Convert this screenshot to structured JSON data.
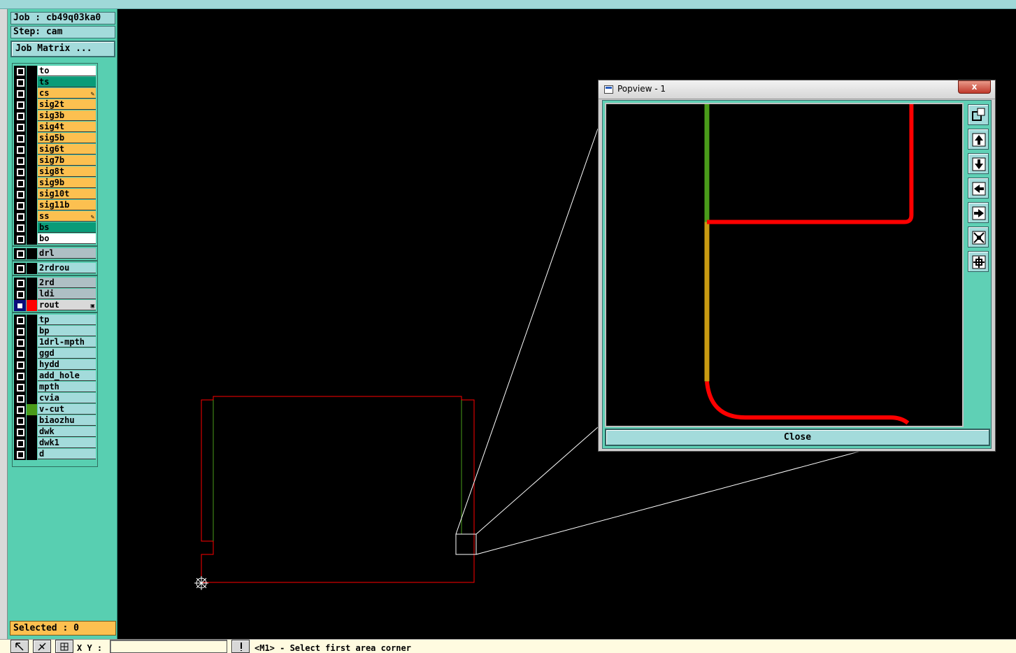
{
  "job": {
    "label": "Job : cb49q03ka0",
    "step_label": "Step: cam",
    "matrix_button": "Job Matrix ..."
  },
  "layers": [
    {
      "name": "to",
      "color": "#ffffff",
      "bg": "#ffffff"
    },
    {
      "name": "ts",
      "color": "#000000",
      "bg": "#0a9b78"
    },
    {
      "name": "cs",
      "color": "#000000",
      "bg": "#fcc050",
      "mark": "✎"
    },
    {
      "name": "sig2t",
      "color": "#000000",
      "bg": "#fcc050"
    },
    {
      "name": "sig3b",
      "color": "#000000",
      "bg": "#fcc050"
    },
    {
      "name": "sig4t",
      "color": "#000000",
      "bg": "#fcc050"
    },
    {
      "name": "sig5b",
      "color": "#000000",
      "bg": "#fcc050"
    },
    {
      "name": "sig6t",
      "color": "#000000",
      "bg": "#fcc050"
    },
    {
      "name": "sig7b",
      "color": "#000000",
      "bg": "#fcc050"
    },
    {
      "name": "sig8t",
      "color": "#000000",
      "bg": "#fcc050"
    },
    {
      "name": "sig9b",
      "color": "#000000",
      "bg": "#fcc050"
    },
    {
      "name": "sig10t",
      "color": "#000000",
      "bg": "#fcc050"
    },
    {
      "name": "sig11b",
      "color": "#000000",
      "bg": "#fcc050"
    },
    {
      "name": "ss",
      "color": "#000000",
      "bg": "#fcc050",
      "mark": "✎"
    },
    {
      "name": "bs",
      "color": "#000000",
      "bg": "#0a9b78"
    },
    {
      "name": "bo",
      "color": "#000000",
      "bg": "#ffffff"
    },
    {
      "name": "drl",
      "color": "#000000",
      "bg": "#aebfc4"
    },
    {
      "name": "2rdrou",
      "color": "#000000",
      "bg": "#a3dbdb"
    },
    {
      "name": "2rd",
      "color": "#000000",
      "bg": "#aebfc4"
    },
    {
      "name": "ldi",
      "color": "#000000",
      "bg": "#aebfc4"
    },
    {
      "name": "rout",
      "color": "#ff0000",
      "bg": "#d9d9d9",
      "mark": "▣",
      "active": true
    },
    {
      "name": "tp",
      "color": "#000000",
      "bg": "#a3dbdb"
    },
    {
      "name": "bp",
      "color": "#000000",
      "bg": "#a3dbdb"
    },
    {
      "name": "1drl-mpth",
      "color": "#000000",
      "bg": "#a3dbdb"
    },
    {
      "name": "ggd",
      "color": "#000000",
      "bg": "#a3dbdb"
    },
    {
      "name": "hydd",
      "color": "#000000",
      "bg": "#a3dbdb"
    },
    {
      "name": "add_hole",
      "color": "#000000",
      "bg": "#a3dbdb"
    },
    {
      "name": "mpth",
      "color": "#000000",
      "bg": "#a3dbdb"
    },
    {
      "name": "cvia",
      "color": "#000000",
      "bg": "#a3dbdb"
    },
    {
      "name": "v-cut",
      "color": "#4a9b1a",
      "bg": "#a3dbdb"
    },
    {
      "name": "biaozhu",
      "color": "#000000",
      "bg": "#a3dbdb"
    },
    {
      "name": "dwk",
      "color": "#000000",
      "bg": "#a3dbdb"
    },
    {
      "name": "dwk1",
      "color": "#000000",
      "bg": "#a3dbdb"
    },
    {
      "name": "d",
      "color": "#000000",
      "bg": "#a3dbdb"
    }
  ],
  "selected_label": "Selected : 0",
  "bottom": {
    "xy_label": "X Y :",
    "xy_value": "",
    "status": "<M1> - Select first area corner"
  },
  "popview": {
    "title": "Popview - 1",
    "close_label": "Close",
    "close_x": "x",
    "tools": [
      "zoom-window-icon",
      "pan-up-icon",
      "pan-down-icon",
      "pan-left-icon",
      "pan-right-icon",
      "zoom-in-icon",
      "zoom-out-icon"
    ]
  },
  "colors": {
    "panel": "#58cfb1",
    "button": "#a3dbdb",
    "signal": "#fcc050",
    "rout": "#ff0000",
    "vcut": "#4a9b1a"
  }
}
